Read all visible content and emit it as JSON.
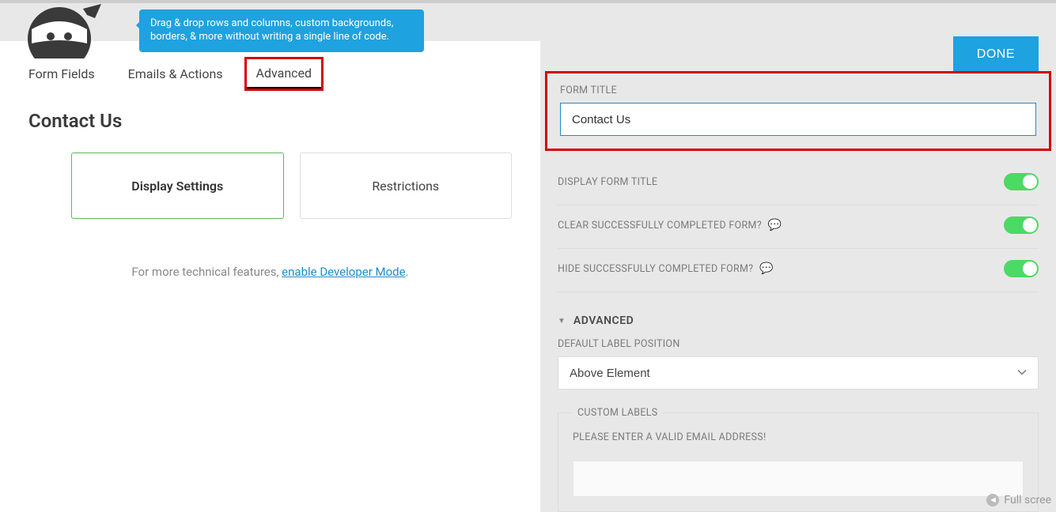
{
  "tooltip": "Drag & drop rows and columns, custom backgrounds, borders, & more without writing a single line of code.",
  "done_button": "DONE",
  "tabs": {
    "form_fields": "Form Fields",
    "emails_actions": "Emails & Actions",
    "advanced": "Advanced"
  },
  "page_title": "Contact Us",
  "cards": {
    "display_settings": "Display Settings",
    "restrictions": "Restrictions"
  },
  "tech_note_prefix": "For more technical features, ",
  "tech_note_link": "enable Developer Mode",
  "tech_note_suffix": ".",
  "right": {
    "form_title_label": "FORM TITLE",
    "form_title_value": "Contact Us",
    "display_form_title": "DISPLAY FORM TITLE",
    "clear_completed": "CLEAR SUCCESSFULLY COMPLETED FORM?",
    "hide_completed": "HIDE SUCCESSFULLY COMPLETED FORM?",
    "advanced_section": "ADVANCED",
    "default_label_position_label": "DEFAULT LABEL POSITION",
    "default_label_position_value": "Above Element",
    "custom_labels_legend": "CUSTOM LABELS",
    "email_error_label": "PLEASE ENTER A VALID EMAIL ADDRESS!"
  },
  "fullscreen_text": "Full scree"
}
